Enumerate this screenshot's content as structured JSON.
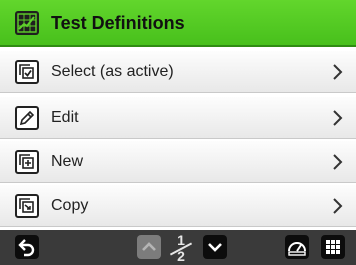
{
  "header": {
    "title": "Test Definitions",
    "icon": "chart-icon",
    "color": "#4cc420"
  },
  "menu": {
    "items": [
      {
        "label": "Select (as active)",
        "icon": "select-active-icon"
      },
      {
        "label": "Edit",
        "icon": "pencil-icon"
      },
      {
        "label": "New",
        "icon": "new-icon"
      },
      {
        "label": "Copy",
        "icon": "copy-icon"
      }
    ]
  },
  "footer": {
    "page_current": "1",
    "page_total": "2",
    "back_icon": "back-arrow-icon",
    "up_icon": "chevron-up-icon",
    "down_icon": "chevron-down-icon",
    "meter_icon": "gauge-icon",
    "grid_icon": "keypad-icon"
  }
}
